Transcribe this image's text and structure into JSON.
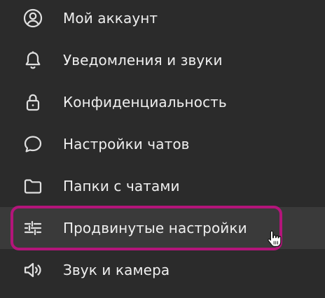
{
  "menu": {
    "items": [
      {
        "label": "Мой аккаунт",
        "icon": "user-circle-icon"
      },
      {
        "label": "Уведомления и звуки",
        "icon": "bell-icon"
      },
      {
        "label": "Конфиденциальность",
        "icon": "lock-icon"
      },
      {
        "label": "Настройки чатов",
        "icon": "chat-bubble-icon"
      },
      {
        "label": "Папки с чатами",
        "icon": "folder-icon"
      },
      {
        "label": "Продвинутые настройки",
        "icon": "sliders-icon",
        "selected": true
      },
      {
        "label": "Звук и камера",
        "icon": "speaker-icon"
      }
    ]
  },
  "colors": {
    "background": "#2b2b2b",
    "selected_background": "#3a3a3a",
    "highlight_border": "#b3157a",
    "text": "#efefef",
    "icon": "#e0e0e0"
  }
}
